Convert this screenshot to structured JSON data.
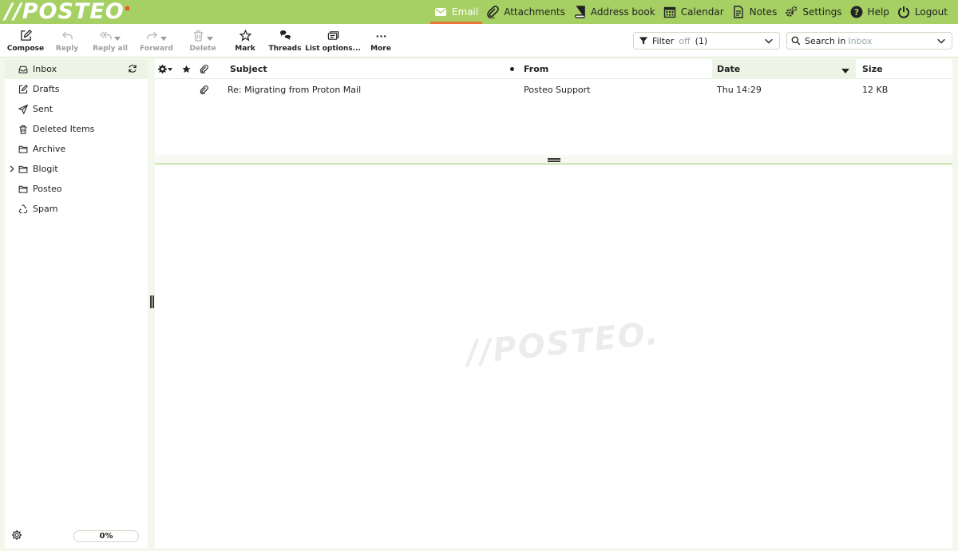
{
  "brand": {
    "logo_text": "//POSTEO",
    "accent_color": "#a6d064",
    "dot_color": "#e8571e"
  },
  "topnav": [
    {
      "label": "Email",
      "icon": "envelope-icon",
      "active": true
    },
    {
      "label": "Attachments",
      "icon": "paperclip-icon"
    },
    {
      "label": "Address book",
      "icon": "book-icon"
    },
    {
      "label": "Calendar",
      "icon": "calendar-icon"
    },
    {
      "label": "Notes",
      "icon": "note-icon"
    },
    {
      "label": "Settings",
      "icon": "gears-icon"
    },
    {
      "label": "Help",
      "icon": "help-icon"
    },
    {
      "label": "Logout",
      "icon": "power-icon"
    }
  ],
  "toolbar": {
    "compose": "Compose",
    "reply": "Reply",
    "reply_all": "Reply all",
    "forward": "Forward",
    "delete": "Delete",
    "mark": "Mark",
    "threads": "Threads",
    "list_options": "List options...",
    "more": "More"
  },
  "filter": {
    "label": "Filter",
    "state": "off",
    "count": "(1)"
  },
  "search": {
    "label": "Search in",
    "scope": "Inbox"
  },
  "folders": [
    {
      "label": "Inbox",
      "icon": "inbox-icon",
      "selected": true
    },
    {
      "label": "Drafts",
      "icon": "edit-icon"
    },
    {
      "label": "Sent",
      "icon": "paper-plane-icon"
    },
    {
      "label": "Deleted Items",
      "icon": "trash-icon"
    },
    {
      "label": "Archive",
      "icon": "folder-icon"
    },
    {
      "label": "Blogit",
      "icon": "folder-icon",
      "expandable": true
    },
    {
      "label": "Posteo",
      "icon": "folder-icon"
    },
    {
      "label": "Spam",
      "icon": "recycle-icon"
    }
  ],
  "quota": {
    "value": "0%"
  },
  "list": {
    "columns": {
      "subject": "Subject",
      "from": "From",
      "date": "Date",
      "size": "Size"
    },
    "sorted_column": "Date",
    "rows": [
      {
        "subject": "Re: Migrating from Proton Mail",
        "from": "Posteo Support",
        "date": "Thu 14:29",
        "size": "12 KB",
        "has_attachment": true
      }
    ]
  },
  "preview": {
    "watermark": "//POSTEO."
  }
}
